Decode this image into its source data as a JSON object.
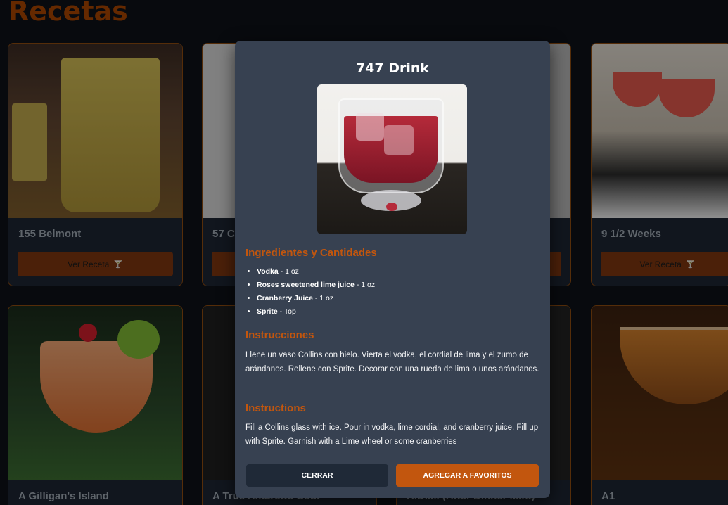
{
  "page": {
    "title": "Recetas"
  },
  "cards": [
    {
      "name": "155 Belmont",
      "button": "Ver Receta"
    },
    {
      "name": "57 C",
      "button": ""
    },
    {
      "name": "",
      "button": ""
    },
    {
      "name": "9 1/2 Weeks",
      "button": "Ver Receta"
    },
    {
      "name": "A Gilligan's Island",
      "button": ""
    },
    {
      "name": "A True Amaretto Sour",
      "button": ""
    },
    {
      "name": "A.D.M. (After Dinner Mint)",
      "button": ""
    },
    {
      "name": "A1",
      "button": ""
    }
  ],
  "modal": {
    "title": "747 Drink",
    "ingredients_heading": "Ingredientes y Cantidades",
    "ingredients": [
      {
        "name": "Vodka",
        "amount": " - 1 oz"
      },
      {
        "name": "Roses sweetened lime juice",
        "amount": " - 1 oz"
      },
      {
        "name": "Cranberry Juice",
        "amount": " - 1 oz"
      },
      {
        "name": "Sprite",
        "amount": " - Top"
      }
    ],
    "instructions_es_heading": "Instrucciones",
    "instructions_es": "Llene un vaso Collins con hielo. Vierta el vodka, el cordial de lima y el zumo de arándanos. Rellene con Sprite. Decorar con una rueda de lima o unos arándanos.",
    "instructions_en_heading": "Instructions",
    "instructions_en": "Fill a Collins glass with ice. Pour in vodka, lime cordial, and cranberry juice. Fill up with Sprite. Garnish with a Lime wheel or some cranberries",
    "close_label": "CERRAR",
    "favorite_label": "AGREGAR A FAVORITOS"
  },
  "colors": {
    "accent": "#c2560e",
    "background": "#0d1117",
    "modal": "#374151"
  }
}
